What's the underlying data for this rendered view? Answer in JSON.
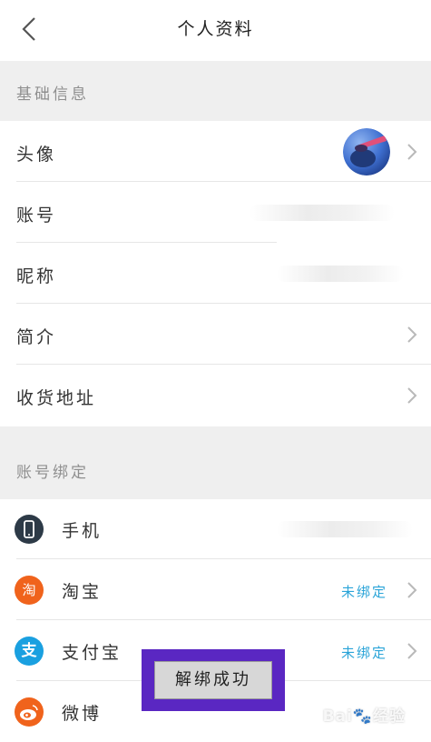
{
  "header": {
    "title": "个人资料"
  },
  "sections": {
    "basic": "基础信息",
    "binding": "账号绑定"
  },
  "profile_rows": {
    "avatar": "头像",
    "account": "账号",
    "nickname": "昵称",
    "bio": "简介",
    "address": "收货地址"
  },
  "bindings": [
    {
      "name": "手机",
      "status": ""
    },
    {
      "name": "淘宝",
      "status": "未绑定",
      "icon_text": "淘"
    },
    {
      "name": "支付宝",
      "status": "未绑定",
      "icon_text": "支"
    },
    {
      "name": "微博",
      "status": ""
    }
  ],
  "toast": {
    "text": "解绑成功"
  },
  "watermark": "Bai🐾经验",
  "colors": {
    "taobao": "#f0631c",
    "alipay": "#1aa0e0",
    "weibo": "#f0631c",
    "phone": "#2d3a47",
    "link": "#2aa4d8"
  },
  "icons": {
    "back": "chevron-left-icon",
    "row_arrow": "chevron-right-icon"
  }
}
